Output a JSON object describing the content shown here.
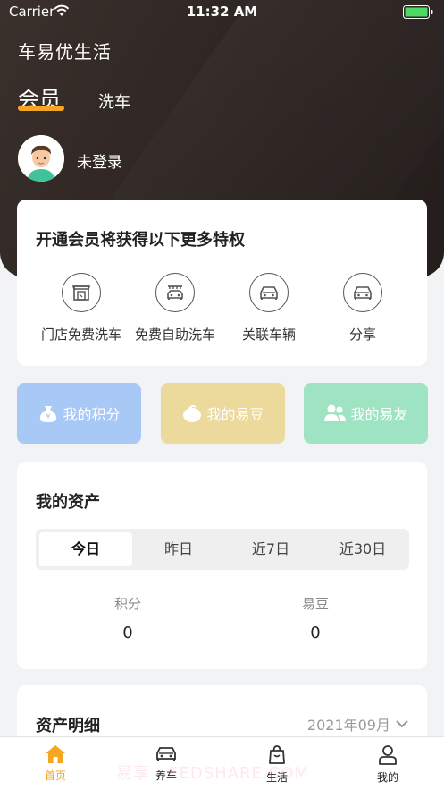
{
  "status_bar": {
    "carrier": "Carrier",
    "time": "11:32 AM"
  },
  "header": {
    "app_title": "车易优生活",
    "tab_member": "会员",
    "tab_wash": "洗车",
    "login_text": "未登录"
  },
  "privileges": {
    "title": "开通会员将获得以下更多特权",
    "items": [
      {
        "label": "门店免费洗车",
        "icon": "store-icon"
      },
      {
        "label": "免费自助洗车",
        "icon": "car-wash-icon"
      },
      {
        "label": "关联车辆",
        "icon": "car-icon"
      },
      {
        "label": "分享",
        "icon": "share-car-icon"
      }
    ]
  },
  "features": [
    {
      "label": "我的积分",
      "icon": "money-bag-icon",
      "color": "#a8c9f5"
    },
    {
      "label": "我的易豆",
      "icon": "bean-icon",
      "color": "#ecd99c"
    },
    {
      "label": "我的易友",
      "icon": "friends-icon",
      "color": "#9ee4c2"
    }
  ],
  "assets": {
    "title": "我的资产",
    "periods": [
      "今日",
      "昨日",
      "近7日",
      "近30日"
    ],
    "active_period": "今日",
    "stats": [
      {
        "label": "积分",
        "value": "0"
      },
      {
        "label": "易豆",
        "value": "0"
      }
    ]
  },
  "details": {
    "title": "资产明细",
    "date": "2021年09月"
  },
  "tabbar": {
    "items": [
      {
        "label": "首页",
        "icon": "home-icon",
        "active": true
      },
      {
        "label": "养车",
        "icon": "car-care-icon",
        "active": false
      },
      {
        "label": "生活",
        "icon": "shopping-bag-icon",
        "active": false
      },
      {
        "label": "我的",
        "icon": "user-icon",
        "active": false
      }
    ],
    "watermark": "易享 · EEDSHARE.COM"
  },
  "colors": {
    "accent": "#f5a623",
    "header_bg": "#2c2421"
  }
}
